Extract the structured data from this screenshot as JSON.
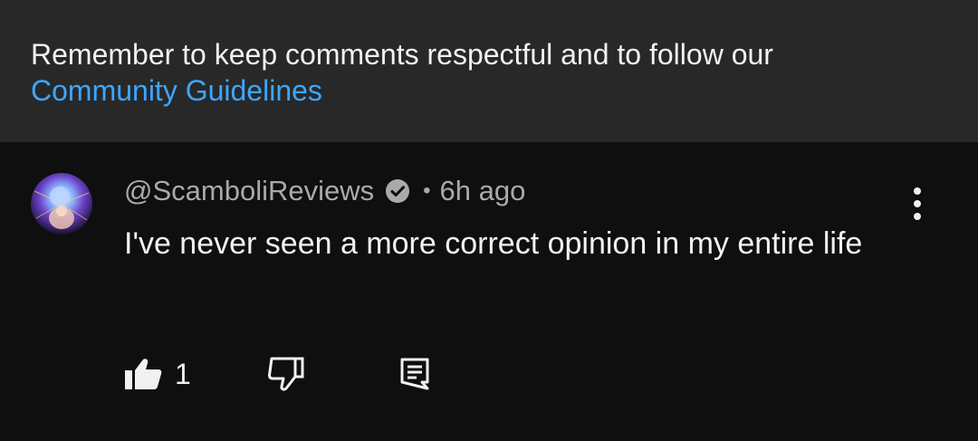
{
  "banner": {
    "message": "Remember to keep comments respectful and to follow our",
    "link_label": "Community Guidelines"
  },
  "comment": {
    "author": "@ScamboliReviews",
    "verified": true,
    "separator": "•",
    "timestamp": "6h ago",
    "text": "I've never seen a more correct opinion in my entire life",
    "like_count": "1"
  },
  "icons": {
    "avatar": "avatar-image",
    "verified": "verified-check-icon",
    "more": "more-vertical-icon",
    "like": "thumbs-up-icon",
    "dislike": "thumbs-down-icon",
    "reply": "reply-comment-icon"
  },
  "colors": {
    "background": "#0f0f0f",
    "banner_background": "#282828",
    "primary_text": "#f1f1f1",
    "secondary_text": "#aaaaaa",
    "link": "#3ea6ff"
  }
}
